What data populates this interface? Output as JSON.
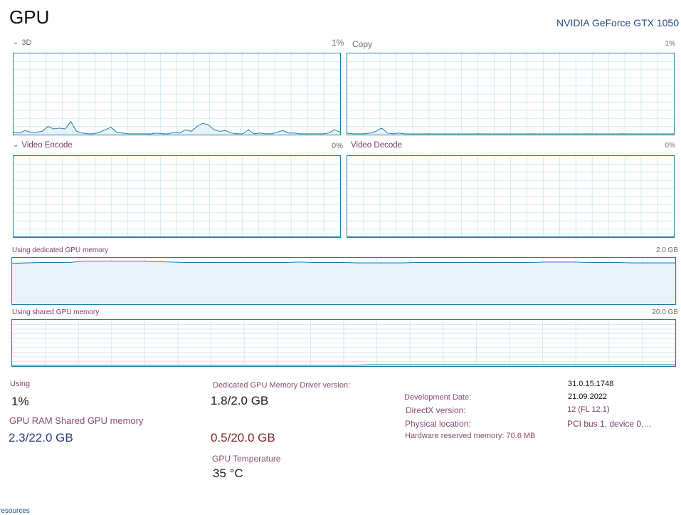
{
  "header": {
    "title": "GPU",
    "gpu_name": "NVIDIA GeForce GTX 1050"
  },
  "graphs": {
    "engine_3d": {
      "label": "3D",
      "value": "1%"
    },
    "copy": {
      "label": "Copy",
      "value": "1%"
    },
    "video_encode": {
      "label": "Video Encode",
      "value": "0%"
    },
    "video_decode": {
      "label": "Video Decode",
      "value": "0%"
    },
    "dedicated_memory": {
      "label": "Using dedicated GPU memory",
      "max": "2.0 GB"
    },
    "shared_memory": {
      "label": "Using shared GPU memory",
      "max": "20.0 GB"
    }
  },
  "series": {
    "engine_3d": [
      3,
      2,
      5,
      3,
      3,
      4,
      10,
      7,
      8,
      7,
      16,
      4,
      2,
      1,
      1,
      3,
      6,
      9,
      3,
      2,
      1,
      1,
      1,
      1,
      0,
      2,
      1,
      1,
      3,
      2,
      6,
      4,
      10,
      14,
      12,
      6,
      4,
      5,
      2,
      1,
      1,
      6,
      1,
      2,
      1,
      1,
      3,
      5,
      2,
      2,
      1,
      1,
      1,
      1,
      0,
      2,
      6,
      3
    ],
    "copy": [
      2,
      1,
      1,
      1,
      2,
      4,
      8,
      2,
      1,
      2,
      1,
      0,
      0,
      0,
      1,
      0,
      0,
      0,
      0,
      0,
      0,
      0,
      0,
      1,
      0,
      0,
      0,
      0,
      0,
      0,
      0,
      0,
      1,
      0,
      0,
      0,
      0,
      0,
      0,
      0,
      0,
      0,
      1,
      0,
      0,
      0,
      0,
      0,
      1,
      0,
      0,
      0,
      0,
      0,
      0,
      0,
      0,
      0
    ],
    "video_encode": [
      0,
      0,
      0,
      0,
      0,
      0,
      0,
      0,
      0,
      0
    ],
    "video_decode": [
      0,
      0,
      0,
      0,
      0,
      0,
      0,
      0,
      0,
      0
    ],
    "dedicated_memory": [
      88,
      89,
      90,
      90,
      90,
      93,
      93,
      93,
      93,
      93,
      92,
      91,
      90,
      90,
      90,
      90,
      90,
      90,
      90,
      90,
      91,
      90,
      90,
      90,
      89,
      89,
      89,
      89,
      90,
      90,
      90,
      90,
      90,
      90,
      90,
      90,
      90,
      91,
      91,
      91,
      90,
      90,
      90,
      89,
      89,
      89,
      89
    ],
    "shared_memory": [
      2,
      2,
      2,
      2,
      2,
      2,
      2,
      2,
      2,
      2,
      2,
      2,
      2,
      2,
      2,
      2,
      2,
      2,
      2,
      2,
      2,
      3,
      3,
      3,
      3,
      3,
      3,
      3,
      3,
      3,
      3,
      3,
      3,
      3,
      3,
      3,
      3,
      3,
      3,
      3
    ]
  },
  "stats": {
    "utilization_label": "Using",
    "utilization_value": "1%",
    "gpu_memory_label": "GPU RAM Shared GPU memory",
    "gpu_memory_value": "2.3/22.0 GB",
    "dedicated_label": "Dedicated GPU Memory Driver version:",
    "dedicated_value": "1.8/2.0 GB",
    "shared_value": "0.5/20.0 GB",
    "temp_label": "GPU Temperature",
    "temp_value": "35 °C"
  },
  "info": {
    "driver_version": "31.0.15.1748",
    "driver_date_label": "Development Date:",
    "driver_date": "21.09.2022",
    "directx_label": "DirectX version:",
    "directx_value": "12 (FL 12.1)",
    "location_label": "Physical location:",
    "location_value": "PCI bus 1, device 0,…",
    "reserved_label": "Hardware reserved memory: 70.6 MB"
  },
  "footer": {
    "link": "resources"
  },
  "colors": {
    "graph_border": "#1e7ea8",
    "graph_line": "#1e7ea8",
    "graph_fill": "#e8f3f9",
    "grid": "#d6e9f3"
  }
}
